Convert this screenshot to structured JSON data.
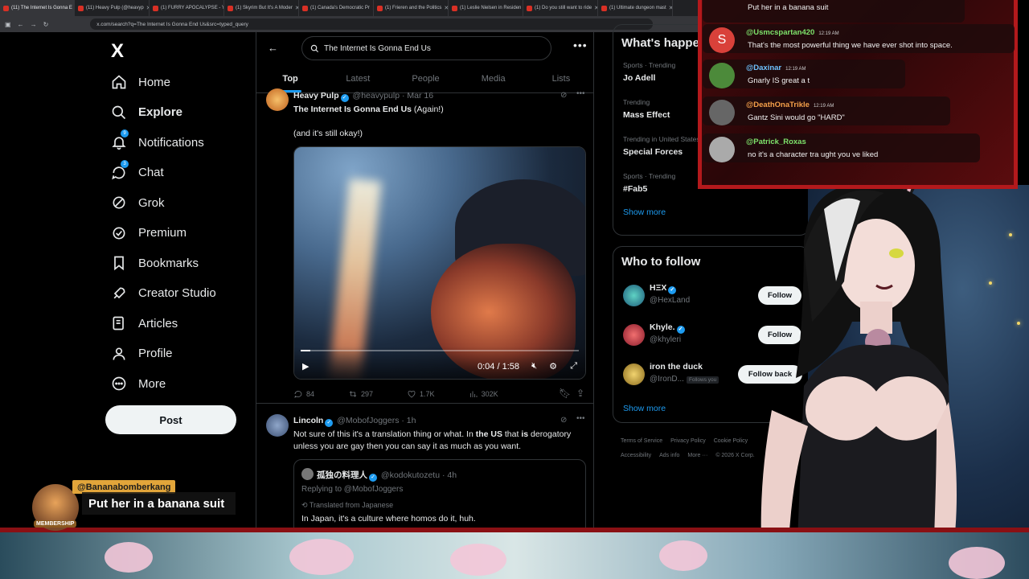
{
  "browser": {
    "tabs": [
      {
        "label": "(11) The Internet Is Gonna E",
        "active": true
      },
      {
        "label": "(11) Heavy Pulp (@heavyp",
        "active": false
      },
      {
        "label": "(1) FURRY APOCALYPSE - Y",
        "active": false
      },
      {
        "label": "(1) Skyrim But It's A Moder",
        "active": false
      },
      {
        "label": "(1) Canada's Democratic Pr",
        "active": false
      },
      {
        "label": "(1) Frieren and the Politics",
        "active": false
      },
      {
        "label": "(1) Leslie Nielsen in Residen",
        "active": false
      },
      {
        "label": "(1) Do you still want to ride",
        "active": false
      },
      {
        "label": "(1) Ultimate dungeon mast",
        "active": false
      }
    ],
    "url": "x.com/search?q=The Internet Is Gonna End Us&src=typed_query"
  },
  "nav": {
    "logo": "X",
    "items": [
      {
        "label": "Home",
        "icon": "home-icon"
      },
      {
        "label": "Explore",
        "icon": "search-icon",
        "bold": true
      },
      {
        "label": "Notifications",
        "icon": "bell-icon",
        "badge": "9"
      },
      {
        "label": "Chat",
        "icon": "chat-icon",
        "badge": "3"
      },
      {
        "label": "Grok",
        "icon": "grok-icon"
      },
      {
        "label": "Premium",
        "icon": "premium-icon"
      },
      {
        "label": "Bookmarks",
        "icon": "bookmark-icon"
      },
      {
        "label": "Creator Studio",
        "icon": "rocket-icon"
      },
      {
        "label": "Articles",
        "icon": "articles-icon"
      },
      {
        "label": "Profile",
        "icon": "profile-icon"
      },
      {
        "label": "More",
        "icon": "more-icon"
      }
    ],
    "post_label": "Post"
  },
  "search": {
    "value": "The Internet Is Gonna End Us",
    "tabs": [
      "Top",
      "Latest",
      "People",
      "Media",
      "Lists"
    ],
    "active_tab": "Top"
  },
  "tweet1": {
    "name": "Heavy Pulp",
    "handle": "@heavypulp · Mar 16",
    "title_bold": "The Internet Is Gonna End Us",
    "title_rest": " (Again!)",
    "body": "(and it's still okay!)",
    "video_time": "0:04 / 1:58",
    "video_progress": 0.034,
    "replies": "84",
    "reposts": "297",
    "likes": "1.7K",
    "views": "302K"
  },
  "tweet2": {
    "name": "Lincoln",
    "handle": "@MobofJoggers · 1h",
    "body_parts": [
      "Not sure of this it's a translation thing or what. In ",
      "the US",
      " that ",
      "is",
      " derogatory unless you are gay then you can say it as much as you want."
    ],
    "quote": {
      "name": "孤独の料理人",
      "handle": "@kodokutozetu · 4h",
      "replying": "Replying to @MobofJoggers",
      "translated": "Translated from Japanese",
      "text": "In Japan, it's a culture where homos do it, huh."
    }
  },
  "trends": {
    "title": "What's happening",
    "items": [
      {
        "context": "Sports · Trending",
        "name": "Jo Adell"
      },
      {
        "context": "Trending",
        "name": "Mass Effect"
      },
      {
        "context": "Trending in United States",
        "name": "Special Forces"
      },
      {
        "context": "Sports · Trending",
        "name": "#Fab5"
      }
    ],
    "show_more": "Show more"
  },
  "who_to_follow": {
    "title": "Who to follow",
    "items": [
      {
        "name": "HΞX",
        "handle": "@HexLand",
        "button": "Follow",
        "verified": true
      },
      {
        "name": "Khyle.",
        "handle": "@khyleri",
        "button": "Follow",
        "verified": true
      },
      {
        "name": "iron the duck",
        "handle": "@IronD...",
        "button": "Follow back",
        "follows_you": "Follows you",
        "verified": false
      }
    ],
    "show_more": "Show more"
  },
  "footer": {
    "line1": [
      "Terms of Service",
      "Privacy Policy",
      "Cookie Policy"
    ],
    "line2": [
      "Accessibility",
      "Ads info",
      "More ···",
      "© 2026 X Corp."
    ]
  },
  "chat": {
    "messages": [
      {
        "user": "",
        "time": "",
        "text": "Put her in a banana suit",
        "color": "#ffffff"
      },
      {
        "user": "@Usmcspartan420",
        "time": "12:19 AM",
        "text": "That's the most powerful thing we have ever shot into space.",
        "color": "#7ee36b",
        "avatar_letter": "S"
      },
      {
        "user": "@Daxinar",
        "time": "12:19 AM",
        "text": "Gnarly IS great a t",
        "color": "#6ec3ff"
      },
      {
        "user": "@DeathOnaTrikle",
        "time": "12:19 AM",
        "text": "Gantz Sini would go \"HARD\"",
        "color": "#f5a04a"
      },
      {
        "user": "@Patrick_Roxas",
        "time": "",
        "text": "no it's a character tra ught you ve liked",
        "color": "#7ee36b"
      }
    ]
  },
  "alert": {
    "username": "@Bananabomberkang",
    "message": "Put her in a banana suit",
    "badge": "MEMBERSHIP"
  }
}
